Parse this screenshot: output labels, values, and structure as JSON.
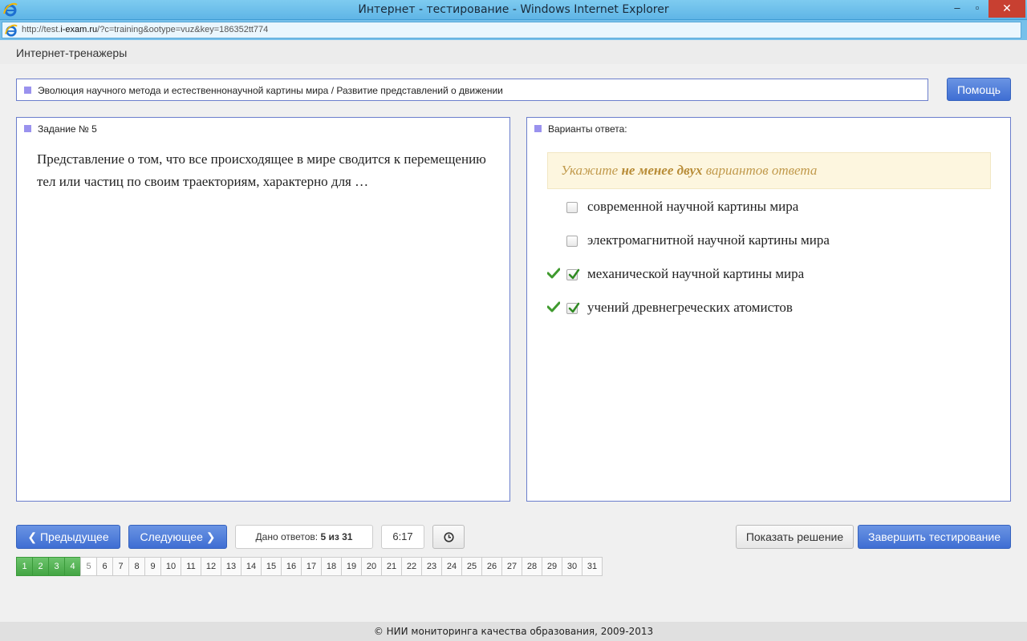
{
  "window": {
    "title": "Интернет - тестирование - Windows Internet Explorer",
    "minimize": "–",
    "maximize": "▫",
    "close": "✕"
  },
  "address": {
    "url_prefix": "http://test.",
    "url_domain": "i-exam.ru",
    "url_rest": "/?c=training&ootype=vuz&key=186352tt774"
  },
  "brand": "Интернет-тренажеры",
  "breadcrumb": "Эволюция научного метода и естественнонаучной картины мира / Развитие представлений о движении",
  "help_label": "Помощь",
  "task": {
    "header": "Задание № 5",
    "question": "Представление о том, что все происходящее в мире сводится к перемещению тел или частиц по своим траекториям, характерно для …"
  },
  "answers": {
    "header": "Варианты ответа:",
    "hint_pre": "Укажите ",
    "hint_bold": "не менее двух",
    "hint_post": " вариантов ответа",
    "options": [
      {
        "label": "современной научной картины мира",
        "checked": false
      },
      {
        "label": "электромагнитной научной картины мира",
        "checked": false
      },
      {
        "label": "механической научной картины мира",
        "checked": true
      },
      {
        "label": "учений древнегреческих атомистов",
        "checked": true
      }
    ]
  },
  "controls": {
    "prev_label": "Предыдущее",
    "next_label": "Следующее",
    "answered_label": "Дано ответов: ",
    "answered_value": "5 из 31",
    "timer": "6:17",
    "show_solution": "Показать решение",
    "finish": "Завершить тестирование"
  },
  "pager": {
    "pages": [
      "1",
      "2",
      "3",
      "4",
      "5",
      "6",
      "7",
      "8",
      "9",
      "10",
      "11",
      "12",
      "13",
      "14",
      "15",
      "16",
      "17",
      "18",
      "19",
      "20",
      "21",
      "22",
      "23",
      "24",
      "25",
      "26",
      "27",
      "28",
      "29",
      "30",
      "31"
    ],
    "done": [
      "1",
      "2",
      "3",
      "4"
    ],
    "current": "5"
  },
  "footer": "© НИИ мониторинга качества образования, 2009-2013",
  "colors": {
    "accent_blue": "#4a78d9",
    "panel_border": "#6b7ecc",
    "done_green": "#4cad4c",
    "hint_bg": "#fdf6df"
  }
}
